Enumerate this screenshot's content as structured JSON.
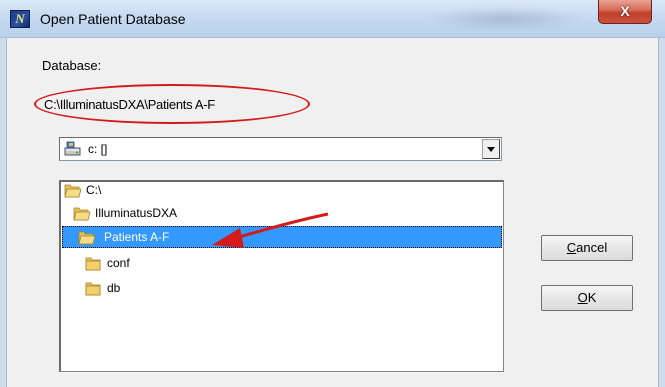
{
  "window": {
    "title": "Open Patient Database",
    "icon_letter": "N",
    "close_label": "X"
  },
  "dialog": {
    "database_label": "Database:",
    "database_path": "C:\\IlluminatusDXA\\Patients A-F",
    "drive": {
      "selected": "c: []",
      "icon": "drive-icon"
    },
    "directories": [
      {
        "name": "C:\\",
        "indent": 0,
        "selected": false
      },
      {
        "name": "IlluminatusDXA",
        "indent": 1,
        "selected": false
      },
      {
        "name": "Patients A-F",
        "indent": 2,
        "selected": true
      },
      {
        "name": "conf",
        "indent": 3,
        "selected": false
      },
      {
        "name": "db",
        "indent": 3,
        "selected": false
      }
    ],
    "buttons": {
      "cancel": {
        "accel": "C",
        "rest": "ancel"
      },
      "ok": {
        "accel": "O",
        "rest": "K"
      }
    }
  },
  "annotations": {
    "ellipse_color": "#d41b1b",
    "arrow_color": "#d41b1b"
  },
  "colors": {
    "selection": "#3399ff",
    "titlebar": "#c5d9f1",
    "close_button": "#c9513b"
  }
}
